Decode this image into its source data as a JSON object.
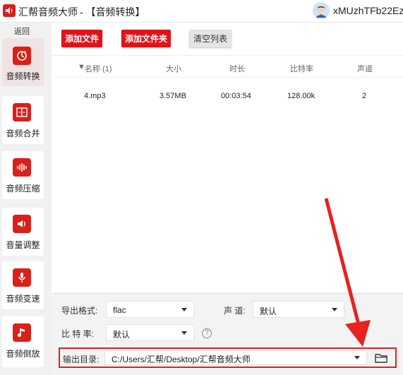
{
  "titlebar": {
    "app_name": "汇帮音频大师",
    "page_name": "- 【音频转换】",
    "username": "xMUzhTFb22Ez"
  },
  "sidebar": {
    "back": "返回",
    "items": [
      {
        "label": "音频转换",
        "icon": "audio-convert-icon",
        "active": true
      },
      {
        "label": "音频合并",
        "icon": "audio-merge-icon",
        "active": false
      },
      {
        "label": "音频压缩",
        "icon": "audio-compress-icon",
        "active": false
      },
      {
        "label": "音量调整",
        "icon": "volume-icon",
        "active": false
      },
      {
        "label": "音频变速",
        "icon": "speed-microphone-icon",
        "active": false
      },
      {
        "label": "音频倒放",
        "icon": "music-note-icon",
        "active": false
      }
    ]
  },
  "toolbar": {
    "add_file": "添加文件",
    "add_folder": "添加文件夹",
    "clear_list": "清空列表"
  },
  "table": {
    "headers": [
      "名称 (1)",
      "大小",
      "时长",
      "比特率",
      "声道"
    ],
    "rows": [
      {
        "name": "4.mp3",
        "size": "3.57MB",
        "duration": "00:03:54",
        "bitrate": "128.00k",
        "channels": "2"
      }
    ]
  },
  "settings": {
    "format_label": "导出格式:",
    "format_value": "flac",
    "channel_label": "声 道:",
    "channel_value": "默认",
    "bitrate_label": "比 特 率:",
    "bitrate_value": "默认",
    "help_glyph": "?",
    "output_label": "输出目录:",
    "output_path": "C:/Users/汇帮/Desktop/汇帮音频大师"
  },
  "colors": {
    "accent": "#e0131a",
    "highlight_border": "#e02020",
    "active_sidebar": "#efe3e4"
  }
}
